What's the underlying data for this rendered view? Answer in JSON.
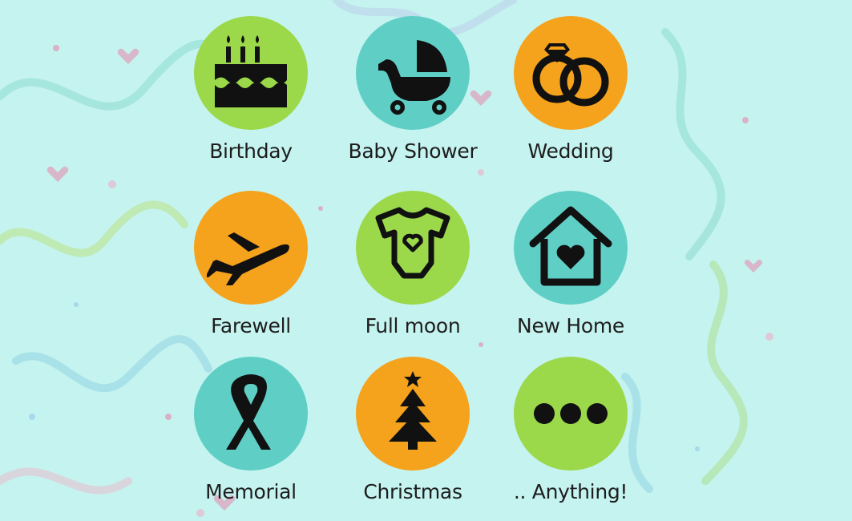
{
  "colors": {
    "green": "#9bd84a",
    "teal": "#5fcfc6",
    "orange": "#f5a21c",
    "background": "#c5f3ef"
  },
  "occasions": [
    {
      "label": "Birthday",
      "icon": "birthday-cake-icon",
      "color": "green"
    },
    {
      "label": "Baby Shower",
      "icon": "baby-stroller-icon",
      "color": "teal"
    },
    {
      "label": "Wedding",
      "icon": "wedding-rings-icon",
      "color": "orange"
    },
    {
      "label": "Farewell",
      "icon": "airplane-icon",
      "color": "orange"
    },
    {
      "label": "Full moon",
      "icon": "baby-onesie-icon",
      "color": "green"
    },
    {
      "label": "New Home",
      "icon": "house-heart-icon",
      "color": "teal"
    },
    {
      "label": "Memorial",
      "icon": "awareness-ribbon-icon",
      "color": "teal"
    },
    {
      "label": "Christmas",
      "icon": "christmas-tree-icon",
      "color": "orange"
    },
    {
      "label": ".. Anything!",
      "icon": "more-dots-icon",
      "color": "green"
    }
  ]
}
